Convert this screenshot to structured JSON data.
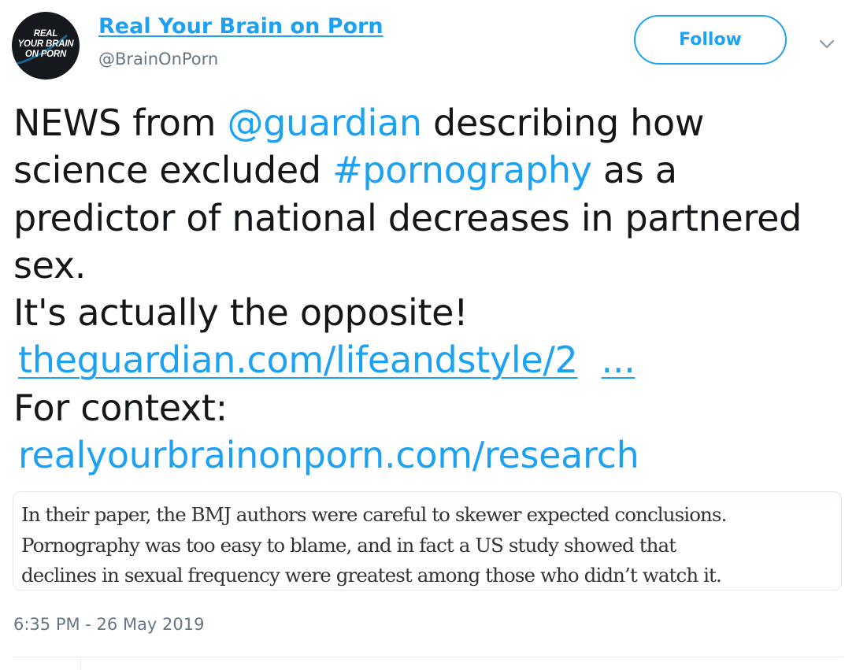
{
  "author": {
    "avatar_lines": [
      "REAL",
      "YOUR BRAIN",
      "ON PORN"
    ],
    "display_name": "Real Your Brain on Porn",
    "handle": "@BrainOnPorn"
  },
  "actions": {
    "follow_label": "Follow",
    "more_icon": "chevron-down-icon"
  },
  "tweet": {
    "line1_pre": "NEWS from ",
    "mention": "@guardian",
    "line1_post": " describing how",
    "line2_pre": "science excluded ",
    "hashtag": "#pornography",
    "line2_post": " as a",
    "line3": "predictor of national decreases in partnered",
    "line4": "sex.",
    "line5": "It's actually the opposite!",
    "link1": "theguardian.com/lifeandstyle/2",
    "link1_ellipsis": "...",
    "line7": "For context:",
    "link2": "realyourbrainonporn.com/research"
  },
  "quote_image": {
    "lines": [
      "In their paper, the BMJ authors were careful to skewer expected conclusions.",
      "Pornography was too easy to blame, and in fact a US study showed that",
      "declines in sexual frequency were greatest among those who didn’t watch it."
    ]
  },
  "timestamp": "6:35 PM - 26 May 2019",
  "colors": {
    "accent": "#1da1f2",
    "text": "#14171a",
    "secondary": "#657786",
    "avatar_bg": "#15181c"
  }
}
